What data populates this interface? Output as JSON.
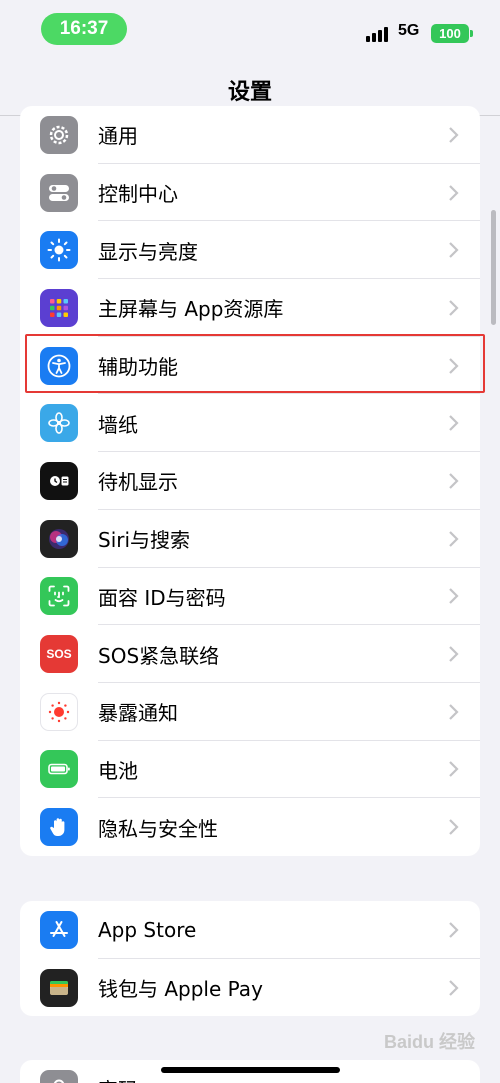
{
  "status": {
    "time": "16:37",
    "network": "5G",
    "battery": "100"
  },
  "nav": {
    "title": "设置"
  },
  "group1": {
    "items": [
      {
        "label": "通用",
        "icon": "gear-icon",
        "color": "#8e8e93"
      },
      {
        "label": "控制中心",
        "icon": "toggles-icon",
        "color": "#8e8e93"
      },
      {
        "label": "显示与亮度",
        "icon": "sun-icon",
        "color": "#1a7cf2"
      },
      {
        "label": "主屏幕与 App资源库",
        "icon": "app-grid-icon",
        "color": "#5b3fd1"
      },
      {
        "label": "辅助功能",
        "icon": "accessibility-icon",
        "color": "#1a7cf2"
      },
      {
        "label": "墙纸",
        "icon": "flower-icon",
        "color": "#3aa8e8"
      },
      {
        "label": "待机显示",
        "icon": "standby-icon",
        "color": "#111111"
      },
      {
        "label": "Siri与搜索",
        "icon": "siri-icon",
        "color": "#222222"
      },
      {
        "label": "面容 ID与密码",
        "icon": "face-id-icon",
        "color": "#34c759"
      },
      {
        "label": "SOS紧急联络",
        "icon": "sos-icon",
        "color": "#e53935"
      },
      {
        "label": "暴露通知",
        "icon": "exposure-icon",
        "color": "#ffffff"
      },
      {
        "label": "电池",
        "icon": "battery-icon",
        "color": "#34c759"
      },
      {
        "label": "隐私与安全性",
        "icon": "hand-icon",
        "color": "#1a7cf2"
      }
    ]
  },
  "group2": {
    "items": [
      {
        "label": "App Store",
        "icon": "app-store-icon",
        "color": "#1a7cf2"
      },
      {
        "label": "钱包与 Apple Pay",
        "icon": "wallet-icon",
        "color": "#222222"
      }
    ]
  },
  "group3": {
    "items": [
      {
        "label": "密码",
        "icon": "key-icon",
        "color": "#8e8e93"
      }
    ]
  },
  "sos_text": "SOS",
  "watermark": "Baidu 经验"
}
